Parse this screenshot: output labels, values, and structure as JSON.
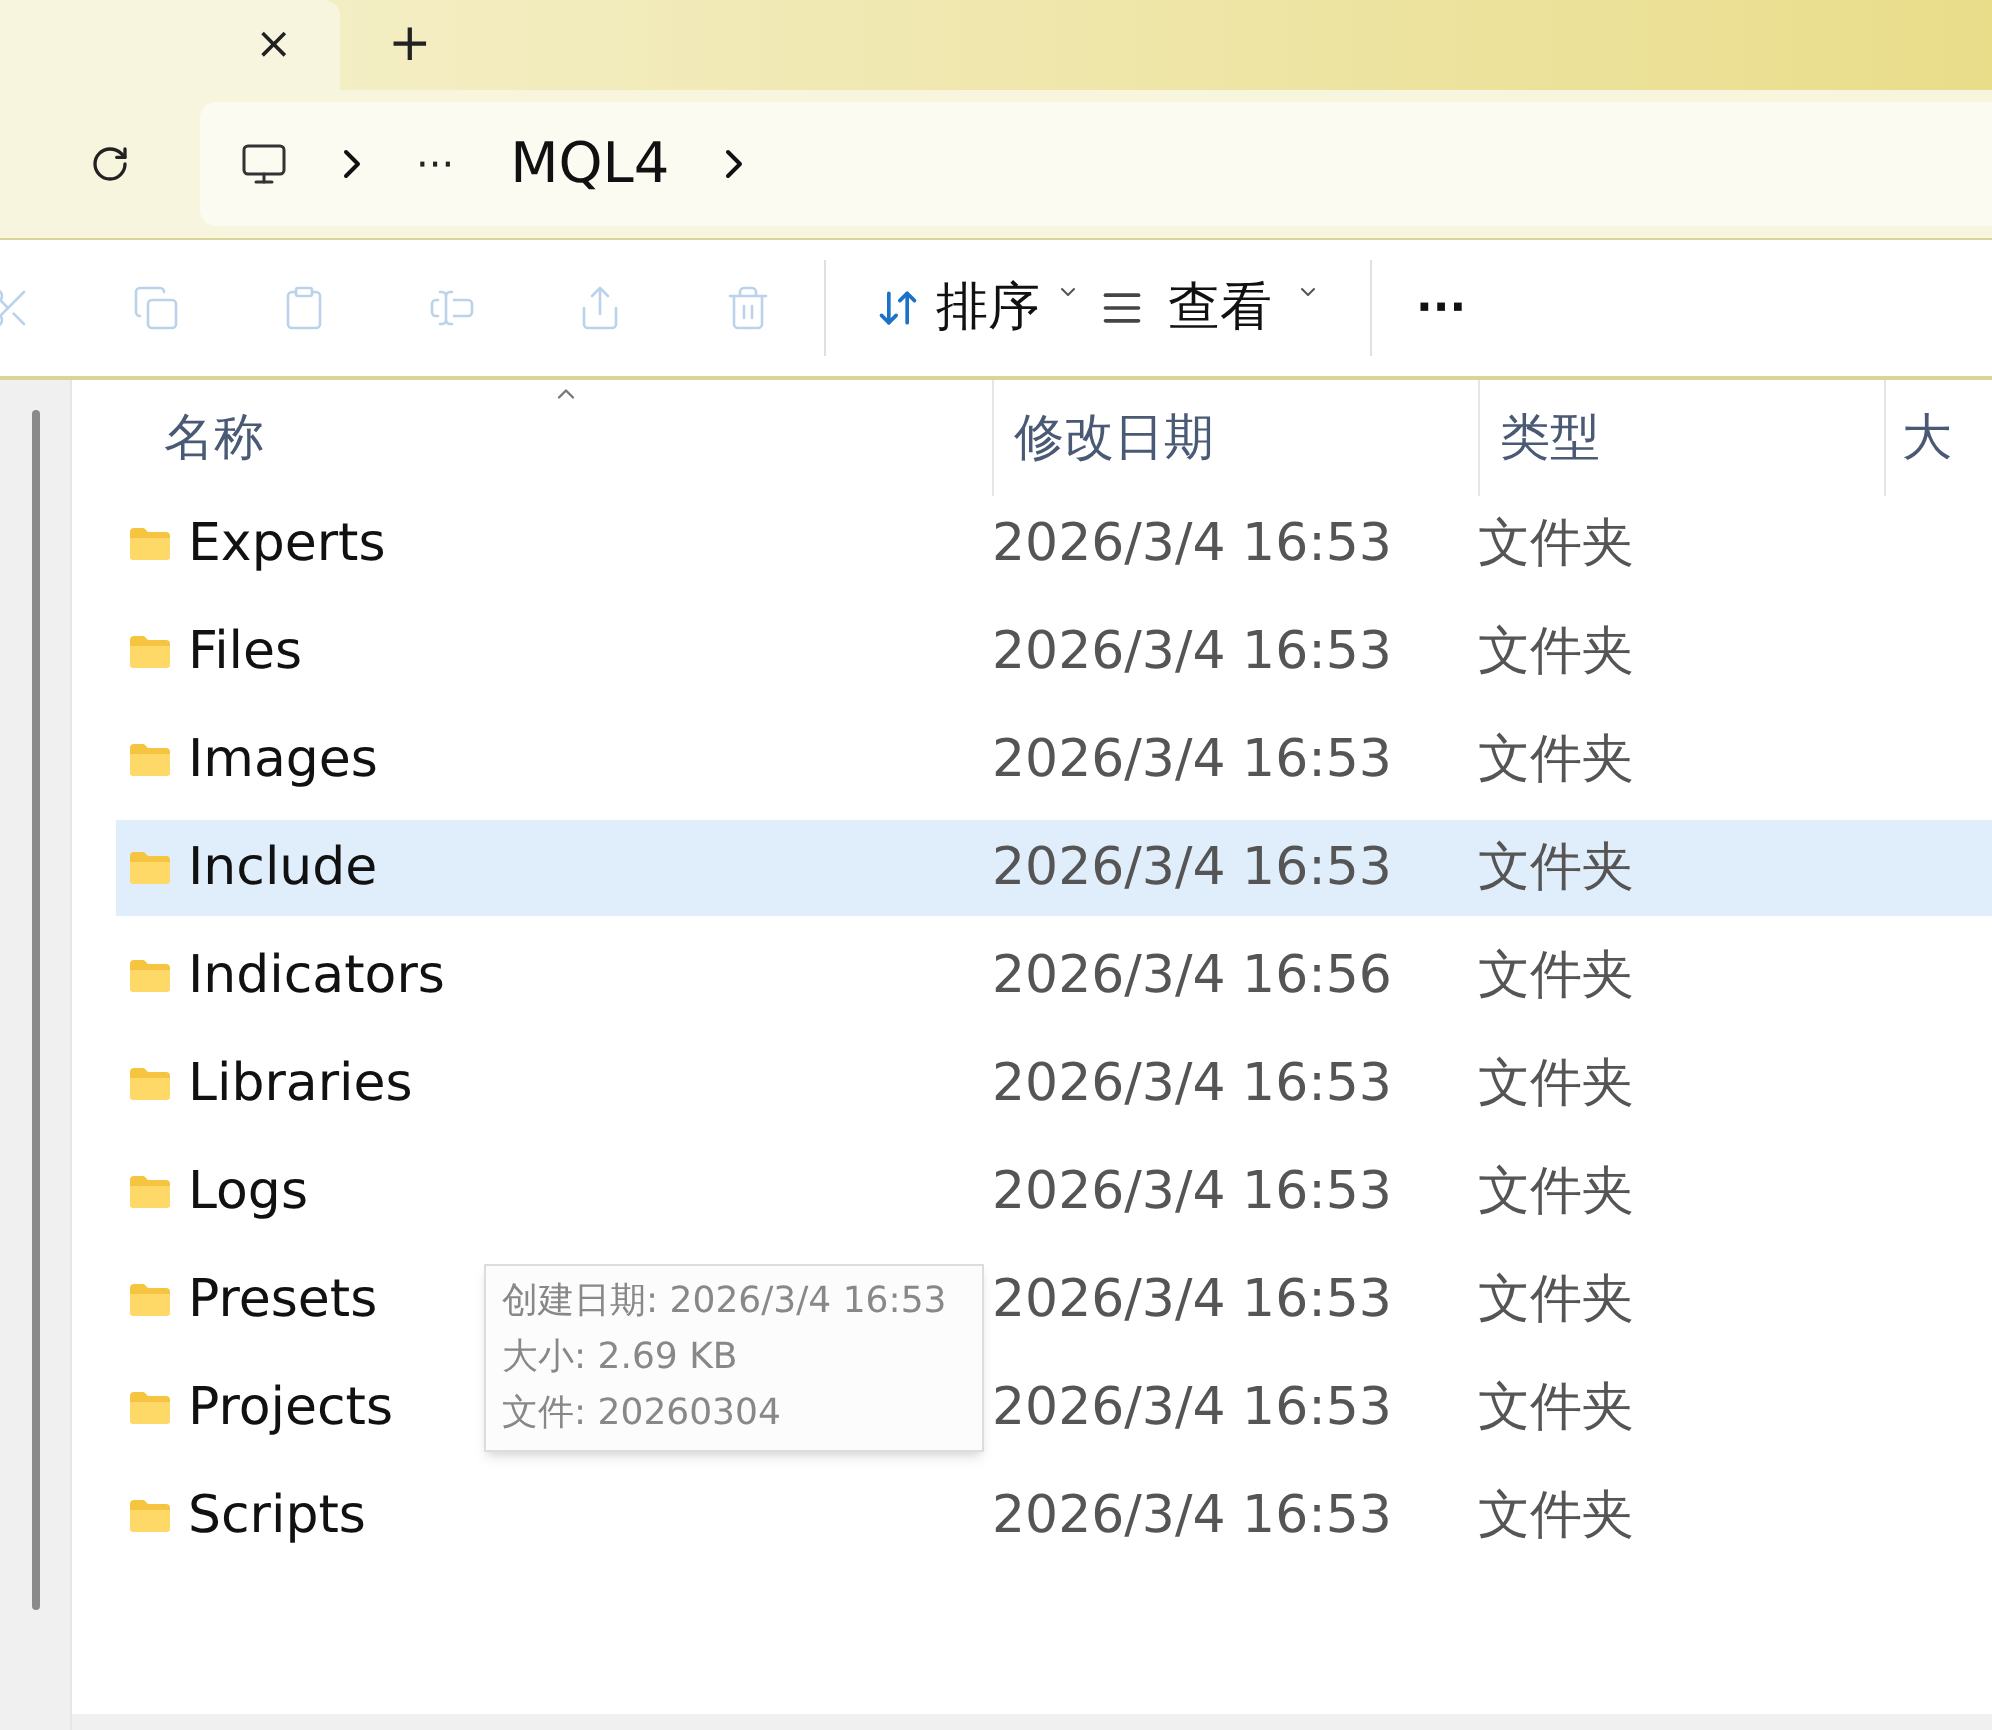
{
  "tabs": [
    {
      "close": "×",
      "selected": true
    }
  ],
  "new_tab": "+",
  "breadcrumb": {
    "more": "···",
    "items": [
      "MQL4"
    ]
  },
  "toolbar": {
    "actions": [
      {
        "kind": "cut",
        "disabled": true
      },
      {
        "kind": "copy",
        "disabled": true
      },
      {
        "kind": "paste",
        "disabled": true
      },
      {
        "kind": "rename",
        "disabled": true
      },
      {
        "kind": "share",
        "disabled": true
      },
      {
        "kind": "delete",
        "disabled": true
      }
    ],
    "sort": "排序",
    "view": "查看",
    "more": "···"
  },
  "table": {
    "columns": [
      "名称",
      "修改日期",
      "类型",
      "大"
    ],
    "rows": [
      {
        "name": "Experts",
        "modified": "2026/3/4 16:53",
        "type": "文件夹",
        "selected": false
      },
      {
        "name": "Files",
        "modified": "2026/3/4 16:53",
        "type": "文件夹",
        "selected": false
      },
      {
        "name": "Images",
        "modified": "2026/3/4 16:53",
        "type": "文件夹",
        "selected": false
      },
      {
        "name": "Include",
        "modified": "2026/3/4 16:53",
        "type": "文件夹",
        "selected": true
      },
      {
        "name": "Indicators",
        "modified": "2026/3/4 16:56",
        "type": "文件夹",
        "selected": false
      },
      {
        "name": "Libraries",
        "modified": "2026/3/4 16:53",
        "type": "文件夹",
        "selected": false
      },
      {
        "name": "Logs",
        "modified": "2026/3/4 16:53",
        "type": "文件夹",
        "selected": false
      },
      {
        "name": "Presets",
        "modified": "2026/3/4 16:53",
        "type": "文件夹",
        "selected": false
      },
      {
        "name": "Projects",
        "modified": "2026/3/4 16:53",
        "type": "文件夹",
        "selected": false
      },
      {
        "name": "Scripts",
        "modified": "2026/3/4 16:53",
        "type": "文件夹",
        "selected": false
      }
    ]
  },
  "tooltip": {
    "lines": [
      "创建日期: 2026/3/4 16:53",
      "大小: 2.69 KB",
      "文件: 20260304"
    ]
  }
}
